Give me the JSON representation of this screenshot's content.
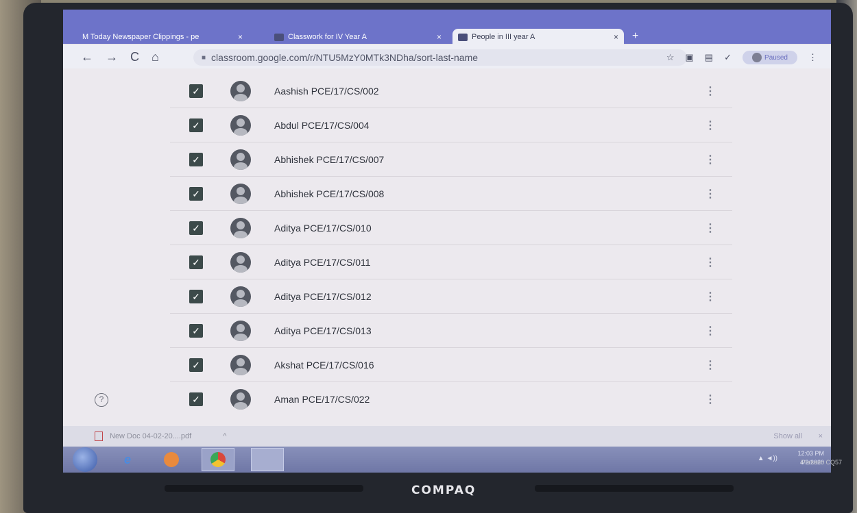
{
  "browser": {
    "tabs": [
      {
        "label": "M  Today Newspaper Clippings - pe",
        "close": "×"
      },
      {
        "label": "Classwork for IV Year A",
        "close": "×"
      },
      {
        "label": "People in III year A",
        "close": "×"
      }
    ],
    "new_tab": "+",
    "back": "←",
    "forward": "→",
    "reload": "C",
    "home": "⌂",
    "url": "classroom.google.com/r/NTU5MzY0MTk3NDha/sort-last-name",
    "star": "☆",
    "profile_label": "Paused"
  },
  "students": [
    {
      "name": "Aashish PCE/17/CS/002"
    },
    {
      "name": "Abdul PCE/17/CS/004"
    },
    {
      "name": "Abhishek PCE/17/CS/007"
    },
    {
      "name": "Abhishek PCE/17/CS/008"
    },
    {
      "name": "Aditya PCE/17/CS/010"
    },
    {
      "name": "Aditya PCE/17/CS/011"
    },
    {
      "name": "Aditya PCE/17/CS/012"
    },
    {
      "name": "Aditya PCE/17/CS/013"
    },
    {
      "name": "Akshat PCE/17/CS/016"
    },
    {
      "name": "Aman PCE/17/CS/022"
    }
  ],
  "help": "?",
  "downloads": {
    "file": "New Doc 04-02-20....pdf",
    "caret": "^",
    "show_all": "Show all",
    "close": "×"
  },
  "taskbar": {
    "clock_time": "12:03 PM",
    "clock_date": "4/2/2020"
  },
  "laptop": {
    "brand": "COMPAQ",
    "model": "Presario CQ57"
  }
}
